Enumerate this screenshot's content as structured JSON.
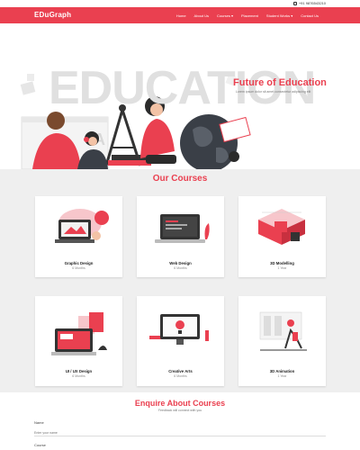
{
  "topbar": {
    "phone": "+91 9876543210"
  },
  "header": {
    "logo": "EDuGraph",
    "nav": [
      "Home",
      "About Us",
      "Courses ▾",
      "Placement",
      "Student Works ▾",
      "Contact Us"
    ]
  },
  "hero": {
    "bg_text": "EDUCATION",
    "title": "Future of Education",
    "subtitle": "Lorem ipsum dolor sit amet consectetur adipiscing elit"
  },
  "courses": {
    "title": "Our Courses",
    "items": [
      {
        "name": "Graphic Design",
        "duration": "6 Months",
        "icon": "graphic-design-illustration"
      },
      {
        "name": "Web Design",
        "duration": "6 Months",
        "icon": "web-design-illustration"
      },
      {
        "name": "3D Modelling",
        "duration": "1 Year",
        "icon": "3d-modelling-illustration"
      },
      {
        "name": "UI / UX Design",
        "duration": "6 Months",
        "icon": "ui-ux-illustration"
      },
      {
        "name": "Creative Arts",
        "duration": "6 Months",
        "icon": "creative-arts-illustration"
      },
      {
        "name": "3D Animation",
        "duration": "1 Year",
        "icon": "3d-animation-illustration"
      }
    ]
  },
  "enquire": {
    "title": "Enquire About Courses",
    "subtitle": "Feedback will connect with you",
    "name_label": "Name",
    "name_placeholder": "Enter your name",
    "course_label": "Course"
  },
  "colors": {
    "brand": "#ea4050",
    "section_bg": "#efefef",
    "text_dark": "#222222"
  }
}
